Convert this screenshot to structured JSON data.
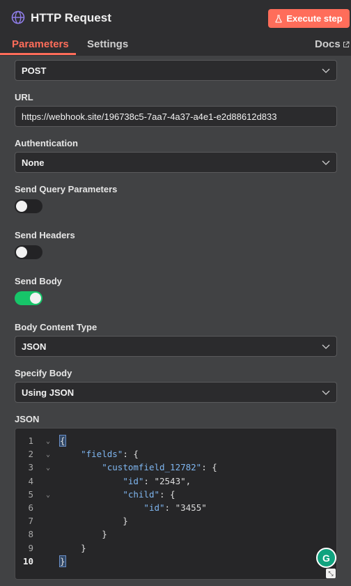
{
  "header": {
    "title": "HTTP Request",
    "execute_label": "Execute step",
    "accent": "#ff6d5a"
  },
  "tabs": {
    "parameters": "Parameters",
    "settings": "Settings",
    "docs": "Docs"
  },
  "fields": {
    "method": {
      "value": "POST"
    },
    "url": {
      "label": "URL",
      "value": "https://webhook.site/196738c5-7aa7-4a37-a4e1-e2d88612d833"
    },
    "authentication": {
      "label": "Authentication",
      "value": "None"
    },
    "send_query": {
      "label": "Send Query Parameters",
      "enabled": false
    },
    "send_headers": {
      "label": "Send Headers",
      "enabled": false
    },
    "send_body": {
      "label": "Send Body",
      "enabled": true
    },
    "body_content_type": {
      "label": "Body Content Type",
      "value": "JSON"
    },
    "specify_body": {
      "label": "Specify Body",
      "value": "Using JSON"
    },
    "json": {
      "label": "JSON"
    }
  },
  "editor": {
    "line_numbers": [
      "1",
      "2",
      "3",
      "4",
      "5",
      "6",
      "7",
      "8",
      "9",
      "10"
    ],
    "active_line": "10",
    "lines": [
      "{",
      "    \"fields\": {",
      "        \"customfield_12782\": {",
      "            \"id\": \"2543\",",
      "            \"child\": {",
      "                \"id\": \"3455\"",
      "            }",
      "        }",
      "    }",
      "}"
    ]
  },
  "toggle_on_color": "#17c569",
  "icons": [
    "globe-icon",
    "flask-icon",
    "external-link-icon",
    "chevron-down-icon",
    "grammarly-icon",
    "resize-icon"
  ]
}
